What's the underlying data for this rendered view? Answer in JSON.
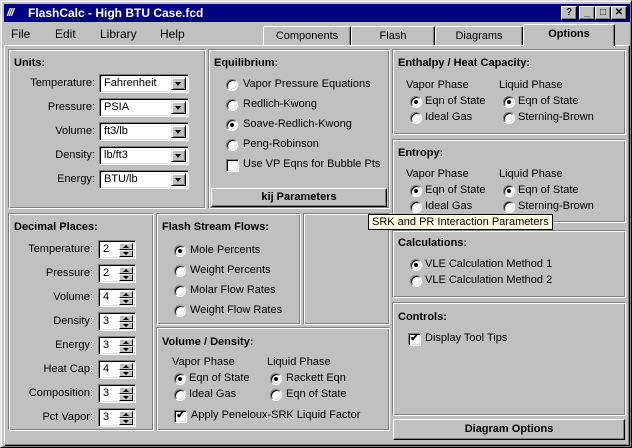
{
  "window": {
    "title": "FlashCalc - High BTU Case.fcd",
    "icon_text": "///",
    "controls": [
      "?",
      "_",
      "□",
      "✕"
    ]
  },
  "menu": [
    {
      "label": "File"
    },
    {
      "label": "Edit"
    },
    {
      "label": "Library"
    },
    {
      "label": "Help"
    }
  ],
  "tabs": [
    {
      "label": "Components"
    },
    {
      "label": "Flash"
    },
    {
      "label": "Diagrams"
    },
    {
      "label": "Options"
    }
  ],
  "units": {
    "heading": "Units:",
    "rows": [
      {
        "label": "Temperature:",
        "value": "Fahrenheit"
      },
      {
        "label": "Pressure:",
        "value": "PSIA"
      },
      {
        "label": "Volume:",
        "value": "ft3/lb"
      },
      {
        "label": "Density:",
        "value": "lb/ft3"
      },
      {
        "label": "Energy:",
        "value": "BTU/lb"
      }
    ]
  },
  "equilibrium": {
    "heading": "Equilibrium:",
    "options": [
      {
        "label": "Vapor Pressure Equations",
        "selected": false
      },
      {
        "label": "Redlich-Kwong",
        "selected": false
      },
      {
        "label": "Soave-Redlich-Kwong",
        "selected": true
      },
      {
        "label": "Peng-Robinson",
        "selected": false
      }
    ],
    "checkbox_label": "Use VP Eqns for Bubble Pts",
    "button_label": "kij Parameters"
  },
  "enthalpy": {
    "heading": "Enthalpy / Heat Capacity:",
    "vapor_label": "Vapor Phase",
    "liquid_label": "Liquid Phase",
    "vapor_options": [
      "Eqn of State",
      "Ideal Gas"
    ],
    "liquid_options": [
      "Eqn of State",
      "Sterning-Brown"
    ]
  },
  "entropy": {
    "heading": "Entropy:",
    "vapor_label": "Vapor Phase",
    "liquid_label": "Liquid Phase",
    "vapor_options": [
      "Eqn of State",
      "Ideal Gas"
    ],
    "liquid_options": [
      "Eqn of State",
      "Sterning-Brown"
    ]
  },
  "tooltip": "SRK and PR Interaction Parameters",
  "decimal": {
    "heading": "Decimal Places:",
    "rows": [
      {
        "label": "Temperature:",
        "value": "2"
      },
      {
        "label": "Pressure:",
        "value": "2"
      },
      {
        "label": "Volume:",
        "value": "4"
      },
      {
        "label": "Density:",
        "value": "3"
      },
      {
        "label": "Energy:",
        "value": "3"
      },
      {
        "label": "Heat Cap:",
        "value": "4"
      },
      {
        "label": "Composition:",
        "value": "3"
      },
      {
        "label": "Pct Vapor:",
        "value": "3"
      }
    ]
  },
  "flash_flows": {
    "heading": "Flash Stream Flows:",
    "options": [
      {
        "label": "Mole Percents",
        "selected": true
      },
      {
        "label": "Weight Percents",
        "selected": false
      },
      {
        "label": "Molar Flow Rates",
        "selected": false
      },
      {
        "label": "Weight Flow Rates",
        "selected": false
      }
    ]
  },
  "volume_density": {
    "heading": "Volume / Density:",
    "vapor_label": "Vapor Phase",
    "liquid_label": "Liquid Phase",
    "vapor_options": [
      "Eqn of State",
      "Ideal Gas"
    ],
    "liquid_options": [
      "Rackett Eqn",
      "Eqn of State"
    ],
    "checkbox_label": "Apply Peneloux-SRK Liquid Factor"
  },
  "calculations": {
    "heading": "Calculations:",
    "options": [
      {
        "label": "VLE Calculation Method 1",
        "selected": true
      },
      {
        "label": "VLE Calculation Method 2",
        "selected": false
      }
    ]
  },
  "controls": {
    "heading": "Controls:",
    "checkbox_label": "Display Tool Tips"
  },
  "diagram_button": "Diagram Options"
}
